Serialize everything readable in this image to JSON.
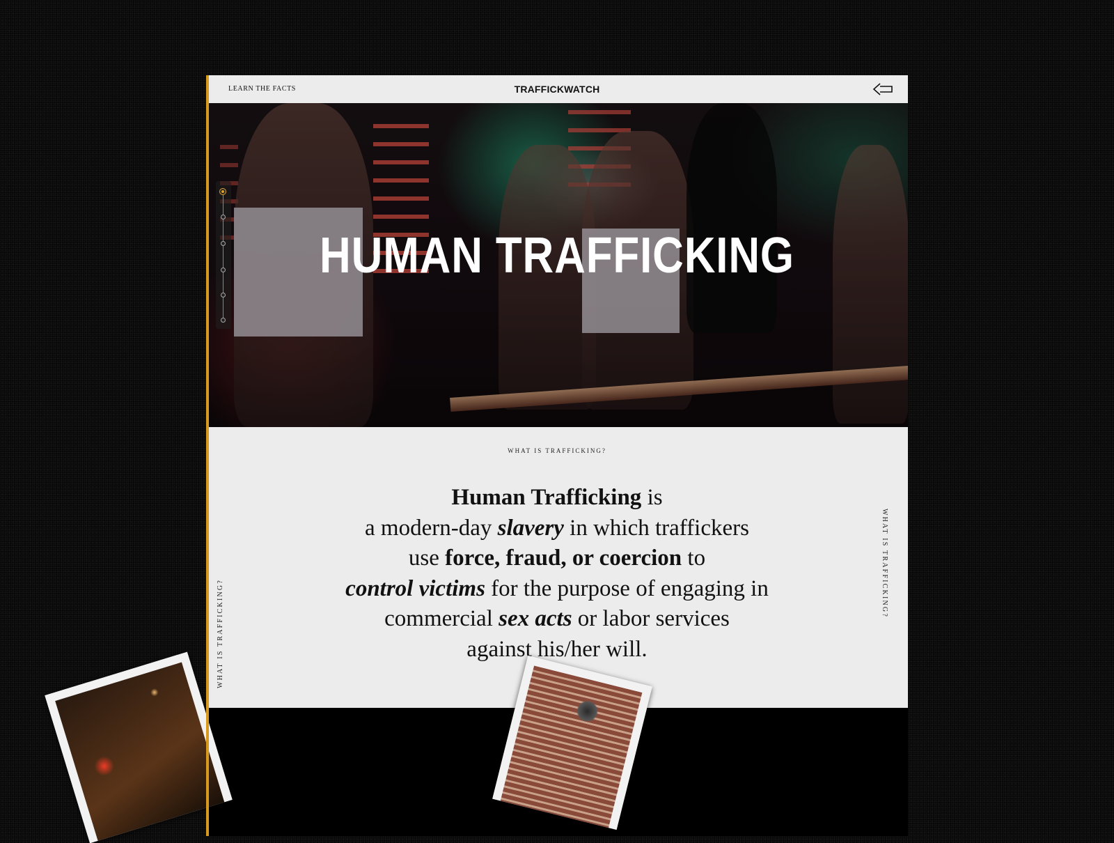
{
  "header": {
    "nav_link": "LEARN THE FACTS",
    "brand": "TRAFFICKWATCH",
    "back_icon": "arrow-left-icon"
  },
  "hero": {
    "title": "HUMAN TRAFFICKING",
    "progress_steps": 6,
    "progress_active": 1
  },
  "section": {
    "label": "WHAT IS TRAFFICKING?",
    "side_label_left": "WHAT IS TRAFFICKING?",
    "side_label_right": "WHAT IS TRAFFICKING?",
    "definition": {
      "term": "Human Trafficking",
      "t1": " is",
      "t2": "a modern-day ",
      "e1": "slavery",
      "t3": " in which traffickers",
      "t4": "use ",
      "b1": "force, fraud, or coercion",
      "t5": " to",
      "e2": "control victims",
      "t6": " for the purpose of engaging in",
      "t7": "commercial ",
      "e3": "sex acts",
      "t8": " or labor services",
      "t9": "against his/her will."
    }
  },
  "colors": {
    "accent": "#d79a1e",
    "page_bg": "#ececec",
    "dark_bg": "#000000",
    "text": "#111111"
  }
}
